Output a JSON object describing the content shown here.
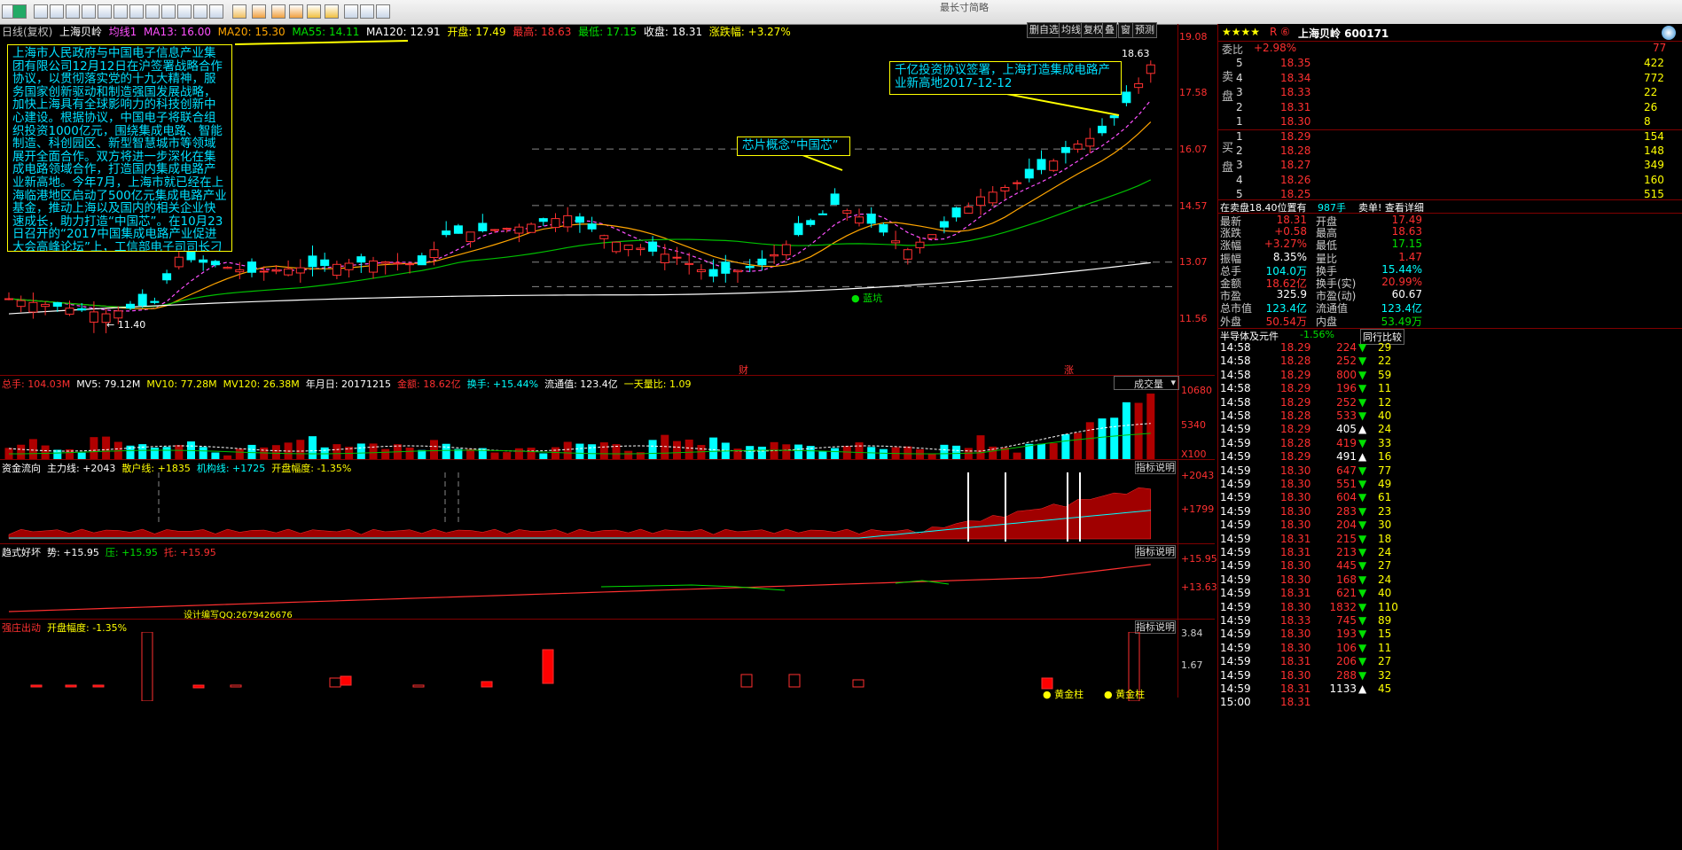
{
  "toolbar": {
    "title": "最长寸简略"
  },
  "header": {
    "period": "日线(复权)",
    "stock_name": "上海贝岭",
    "ma_label": "均线1",
    "ma13": "MA13: 16.00",
    "ma20": "MA20: 15.30",
    "ma55": "MA55: 14.11",
    "ma120": "MA120: 12.91",
    "open": "开盘: 17.49",
    "high": "最高: 18.63",
    "low": "最低: 17.15",
    "close": "收盘: 18.31",
    "change": "涨跌幅: +3.27%"
  },
  "chart_buttons": [
    "删自选",
    "均线",
    "复权",
    "叠",
    "窗",
    "预测"
  ],
  "price_axis": [
    "19.08",
    "17.58",
    "16.07",
    "14.57",
    "13.07",
    "11.56"
  ],
  "annotations": {
    "news_main": "上海市人民政府与中国电子信息产业集团有限公司12月12日在沪签署战略合作协议，以贯彻落实党的十九大精神，服务国家创新驱动和制造强国发展战略，加快上海具有全球影响力的科技创新中心建设。根据协议，中国电子将联合组织投资1000亿元，围绕集成电路、智能制造、科创园区、新型智慧城市等领域展开全面合作。双方将进一步深化在集成电路领域合作，打造国内集成电路产业新高地。今年7月，上海市就已经在上海临港地区启动了500亿元集成电路产业基金，推动上海以及国内的相关企业快速成长，助力打造“中国芯”。在10月23日召开的“2017中国集成电路产业促进大会高峰论坛”上，工信部电子司司长刁石京在致辞时表",
    "news_chip": "芯片概念“中国芯”",
    "news_high": "千亿投资协议签署，上海打造集成电路产业新高地2017-12-12",
    "high_mark": "18.63",
    "low_mark": "← 11.40",
    "blue_label": "蓝坑",
    "cai": "财",
    "zhang": "涨"
  },
  "volume_panel": {
    "total": "总手: 104.03M",
    "mv5": "MV5: 79.12M",
    "mv10": "MV10: 77.28M",
    "mv120": "MV120: 26.38M",
    "date": "年月日: 20171215",
    "amount": "金额: 18.62亿",
    "turnover": "换手: +15.44%",
    "float": "流通值: 123.4亿",
    "ratio": "一天量比: 1.09",
    "selector": "成交量",
    "axis": [
      "10680",
      "5340",
      "X100"
    ]
  },
  "fund_panel": {
    "name": "资金流向",
    "main": "主力线: +2043",
    "retail": "散户线: +1835",
    "inst": "机构线: +1725",
    "open_amp": "开盘幅度: -1.35%",
    "explain": "指标说明",
    "axis": [
      "+2043",
      "+1799"
    ]
  },
  "trend_panel": {
    "name": "趋式好坏",
    "shi": "势: +15.95",
    "ya": "压: +15.95",
    "tuo": "托: +15.95",
    "explain": "指标说明",
    "axis": [
      "+15.95",
      "+13.63"
    ],
    "design": "设计编写QQ:2679426676"
  },
  "strong_panel": {
    "name": "强庄出动",
    "open_amp": "开盘幅度: -1.35%",
    "explain": "指标说明",
    "axis": [
      "3.84",
      "1.67"
    ],
    "gold1": "黄金柱",
    "gold2": "黄金柱"
  },
  "right": {
    "title": "上海贝岭 600171",
    "stars": "★★★★",
    "r": "R ⑥",
    "weibi_label": "委比",
    "weibi": "+2.98%",
    "weibi_num": "77",
    "sell_label": "卖盘",
    "buy_label": "买盘",
    "sells": [
      {
        "lvl": "5",
        "price": "18.35",
        "vol": "422"
      },
      {
        "lvl": "4",
        "price": "18.34",
        "vol": "772"
      },
      {
        "lvl": "3",
        "price": "18.33",
        "vol": "22"
      },
      {
        "lvl": "2",
        "price": "18.31",
        "vol": "26"
      },
      {
        "lvl": "1",
        "price": "18.30",
        "vol": "8"
      }
    ],
    "buys": [
      {
        "lvl": "1",
        "price": "18.29",
        "vol": "154"
      },
      {
        "lvl": "2",
        "price": "18.28",
        "vol": "148"
      },
      {
        "lvl": "3",
        "price": "18.27",
        "vol": "349"
      },
      {
        "lvl": "4",
        "price": "18.26",
        "vol": "160"
      },
      {
        "lvl": "5",
        "price": "18.25",
        "vol": "515"
      }
    ],
    "notice": "在卖盘18.40位置有",
    "notice_vol": "987手",
    "notice_tail": "卖单! 查看详细",
    "quote": [
      {
        "l1": "最新",
        "v1": "18.31",
        "l2": "开盘",
        "v2": "17.49"
      },
      {
        "l1": "涨跌",
        "v1": "+0.58",
        "l2": "最高",
        "v2": "18.63"
      },
      {
        "l1": "涨幅",
        "v1": "+3.27%",
        "l2": "最低",
        "v2": "17.15"
      },
      {
        "l1": "振幅",
        "v1": "8.35%",
        "l2": "量比",
        "v2": "1.47"
      },
      {
        "l1": "总手",
        "v1": "104.0万",
        "l2": "换手",
        "v2": "15.44%"
      },
      {
        "l1": "金额",
        "v1": "18.62亿",
        "l2": "换手(实)",
        "v2": "20.99%"
      },
      {
        "l1": "市盈",
        "v1": "325.9",
        "l2": "市盈(动)",
        "v2": "60.67"
      },
      {
        "l1": "总市值",
        "v1": "123.4亿",
        "l2": "流通值",
        "v2": "123.4亿"
      },
      {
        "l1": "外盘",
        "v1": "50.54万",
        "l2": "内盘",
        "v2": "53.49万"
      }
    ],
    "sector": "半导体及元件",
    "sector_chg": "-1.56%",
    "sector_btn": "同行比较",
    "ticks": [
      {
        "t": "14:58",
        "p": "18.29",
        "v": "224",
        "d": "down",
        "x": "29"
      },
      {
        "t": "14:58",
        "p": "18.28",
        "v": "252",
        "d": "down",
        "x": "22"
      },
      {
        "t": "14:58",
        "p": "18.29",
        "v": "800",
        "d": "down",
        "x": "59"
      },
      {
        "t": "14:58",
        "p": "18.29",
        "v": "196",
        "d": "down",
        "x": "11"
      },
      {
        "t": "14:58",
        "p": "18.29",
        "v": "252",
        "d": "down",
        "x": "12"
      },
      {
        "t": "14:58",
        "p": "18.28",
        "v": "533",
        "d": "down",
        "x": "40"
      },
      {
        "t": "14:59",
        "p": "18.29",
        "v": "405",
        "d": "up",
        "x": "24"
      },
      {
        "t": "14:59",
        "p": "18.28",
        "v": "419",
        "d": "down",
        "x": "33"
      },
      {
        "t": "14:59",
        "p": "18.29",
        "v": "491",
        "d": "up",
        "x": "16"
      },
      {
        "t": "14:59",
        "p": "18.30",
        "v": "647",
        "d": "down",
        "x": "77"
      },
      {
        "t": "14:59",
        "p": "18.30",
        "v": "551",
        "d": "down",
        "x": "49"
      },
      {
        "t": "14:59",
        "p": "18.30",
        "v": "604",
        "d": "down",
        "x": "61"
      },
      {
        "t": "14:59",
        "p": "18.30",
        "v": "283",
        "d": "down",
        "x": "23"
      },
      {
        "t": "14:59",
        "p": "18.30",
        "v": "204",
        "d": "down",
        "x": "30"
      },
      {
        "t": "14:59",
        "p": "18.31",
        "v": "215",
        "d": "down",
        "x": "18"
      },
      {
        "t": "14:59",
        "p": "18.31",
        "v": "213",
        "d": "down",
        "x": "24"
      },
      {
        "t": "14:59",
        "p": "18.30",
        "v": "445",
        "d": "down",
        "x": "27"
      },
      {
        "t": "14:59",
        "p": "18.30",
        "v": "168",
        "d": "down",
        "x": "24"
      },
      {
        "t": "14:59",
        "p": "18.31",
        "v": "621",
        "d": "down",
        "x": "40"
      },
      {
        "t": "14:59",
        "p": "18.30",
        "v": "1832",
        "d": "down",
        "x": "110"
      },
      {
        "t": "14:59",
        "p": "18.33",
        "v": "745",
        "d": "down",
        "x": "89"
      },
      {
        "t": "14:59",
        "p": "18.30",
        "v": "193",
        "d": "down",
        "x": "15"
      },
      {
        "t": "14:59",
        "p": "18.30",
        "v": "106",
        "d": "down",
        "x": "11"
      },
      {
        "t": "14:59",
        "p": "18.31",
        "v": "206",
        "d": "down",
        "x": "27"
      },
      {
        "t": "14:59",
        "p": "18.30",
        "v": "288",
        "d": "down",
        "x": "32"
      },
      {
        "t": "14:59",
        "p": "18.31",
        "v": "1133",
        "d": "up",
        "x": "45"
      },
      {
        "t": "15:00",
        "p": "18.31",
        "v": "",
        "d": "",
        "x": ""
      }
    ]
  },
  "colors": {
    "up": "#ff3030",
    "down": "#00ffff",
    "ma13": "#ff50ff",
    "ma20": "#ffa500",
    "ma55": "#00c000",
    "ma120": "#ffffff"
  }
}
